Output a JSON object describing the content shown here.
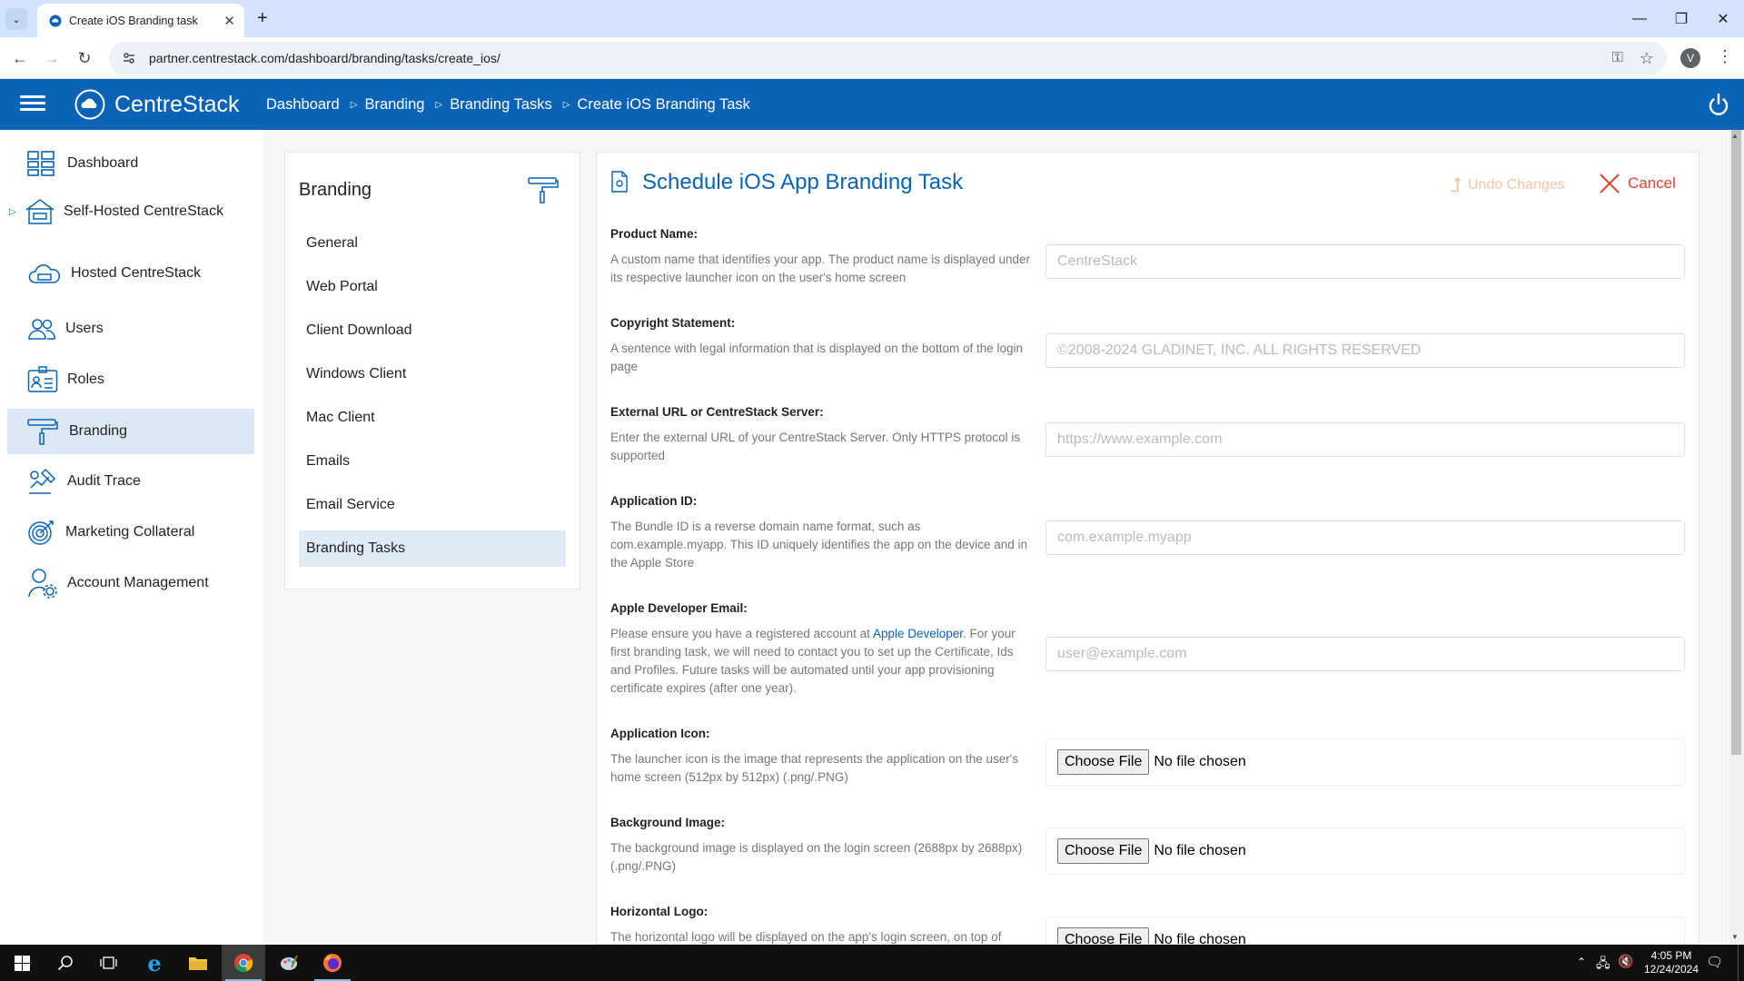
{
  "browser": {
    "tab_title": "Create iOS Branding task",
    "url": "partner.centrestack.com/dashboard/branding/tasks/create_ios/",
    "profile_initial": "V"
  },
  "header": {
    "brand": "CentreStack",
    "breadcrumbs": [
      "Dashboard",
      "Branding",
      "Branding Tasks",
      "Create iOS Branding Task"
    ],
    "color": "#0a63b6"
  },
  "sidebar": {
    "items": [
      {
        "label": "Dashboard",
        "icon": "dashboard-grid-icon"
      },
      {
        "label": "Self-Hosted CentreStack",
        "icon": "self-hosted-icon"
      },
      {
        "label": "Hosted CentreStack",
        "icon": "cloud-server-icon"
      },
      {
        "label": "Users",
        "icon": "users-icon"
      },
      {
        "label": "Roles",
        "icon": "roles-icon"
      },
      {
        "label": "Branding",
        "icon": "paint-roller-icon"
      },
      {
        "label": "Audit Trace",
        "icon": "audit-trace-icon"
      },
      {
        "label": "Marketing Collateral",
        "icon": "target-icon"
      },
      {
        "label": "Account Management",
        "icon": "account-gear-icon"
      }
    ],
    "active": "Branding"
  },
  "branding_panel": {
    "title": "Branding",
    "items": [
      "General",
      "Web Portal",
      "Client Download",
      "Windows Client",
      "Mac Client",
      "Emails",
      "Email Service",
      "Branding Tasks"
    ],
    "active": "Branding Tasks"
  },
  "form": {
    "title": "Schedule iOS App Branding Task",
    "undo_label": "Undo Changes",
    "cancel_label": "Cancel",
    "fields": [
      {
        "label": "Product Name:",
        "desc": "A custom name that identifies your app. The product name is displayed under its respective launcher icon on the user's home screen",
        "placeholder": "CentreStack"
      },
      {
        "label": "Copyright Statement:",
        "desc": "A sentence with legal information that is displayed on the bottom of the login page",
        "placeholder": "©2008-2024 GLADINET, INC. ALL RIGHTS RESERVED"
      },
      {
        "label": "External URL or CentreStack Server:",
        "desc": "Enter the external URL of your CentreStack Server. Only HTTPS protocol is supported",
        "placeholder": "https://www.example.com"
      },
      {
        "label": "Application ID:",
        "desc": "The Bundle ID is a reverse domain name format, such as com.example.myapp. This ID uniquely identifies the app on the device and in the Apple Store",
        "placeholder": "com.example.myapp"
      },
      {
        "label": "Apple Developer Email:",
        "desc_before": "Please ensure you have a registered account at ",
        "desc_link": "Apple Developer",
        "desc_after": ". For your first branding task, we will need to contact you to set up the Certificate, Ids and Profiles. Future tasks will be automated until your app provisioning certificate expires (after one year).",
        "placeholder": "user@example.com"
      },
      {
        "label": "Application Icon:",
        "desc": "The launcher icon is the image that represents the application on the user's home screen (512px by 512px) (.png/.PNG)"
      },
      {
        "label": "Background Image:",
        "desc": "The background image is displayed on the login screen (2688px by 2688px) (.png/.PNG)"
      },
      {
        "label": "Horizontal Logo:",
        "desc": "The horizontal logo will be displayed on the app's login screen, on top of"
      }
    ],
    "file_button": "Choose File",
    "file_status": "No file chosen"
  },
  "taskbar": {
    "time": "4:05 PM",
    "date": "12/24/2024"
  }
}
